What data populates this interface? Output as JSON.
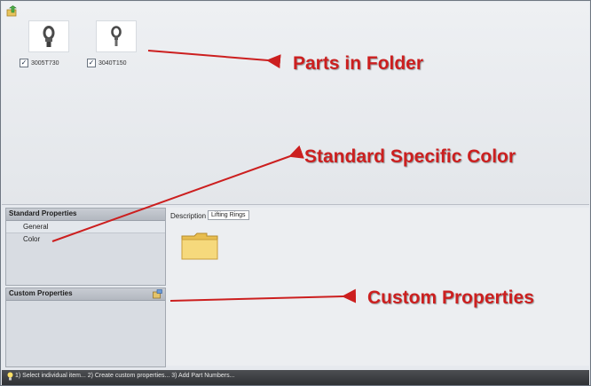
{
  "parts": [
    {
      "name": "3005T730",
      "checked": true
    },
    {
      "name": "3040T150",
      "checked": true
    }
  ],
  "standard_properties": {
    "title": "Standard Properties",
    "items": [
      "General",
      "Color"
    ]
  },
  "custom_properties": {
    "title": "Custom Properties"
  },
  "description": {
    "label": "Description",
    "value": "Lifting Rings"
  },
  "status_bar": {
    "text": "1) Select individual item... 2) Create custom properties... 3) Add Part Numbers..."
  },
  "annotations": {
    "parts_in_folder": "Parts in Folder",
    "standard_specific_color": "Standard Specific Color",
    "custom_properties": "Custom Properties"
  },
  "colors": {
    "annotation": "#cc1f1f",
    "status_bar": "#3a3c40",
    "folder": "#f3d270"
  },
  "icons": [
    "folder-up-icon",
    "lifting-ring-icon",
    "checkbox-icon",
    "folder-icon",
    "add-property-icon",
    "lightbulb-icon"
  ]
}
